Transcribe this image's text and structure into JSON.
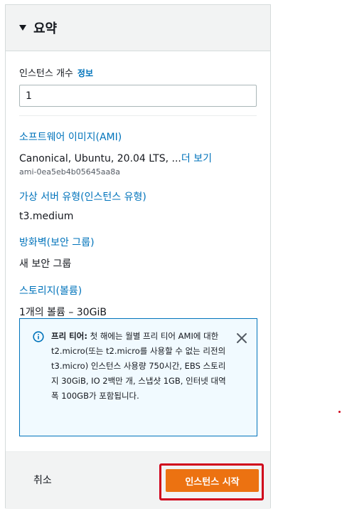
{
  "summary": {
    "title": "요약",
    "instance_count_label": "인스턴스 개수",
    "instance_count_info": "정보",
    "instance_count_value": "1",
    "ami_link": "소프트웨어 이미지(AMI)",
    "ami_value": "Canonical, Ubuntu, 20.04 LTS, ...",
    "ami_more_link": "더 보기",
    "ami_id": "ami-0ea5eb4b05645aa8a",
    "instance_type_link": "가상 서버 유형(인스턴스 유형)",
    "instance_type_value": "t3.medium",
    "firewall_link": "방화벽(보안 그룹)",
    "firewall_value": "새 보안 그룹",
    "storage_link": "스토리지(볼륨)",
    "storage_value": "1개의 볼륨 – 30GiB"
  },
  "free_tier_alert": {
    "title": "프리 티어:",
    "body": " 첫 해에는 월별 프리 티어 AMI에 대한 t2.micro(또는 t2.micro를 사용할 수 없는 리전의 t3.micro) 인스턴스 사용량 750시간, EBS 스토리지 30GiB, IO 2백만 개, 스냅샷 1GB, 인터넷 대역폭 100GB가 포함됩니다."
  },
  "footer": {
    "cancel_label": "취소",
    "launch_label": "인스턴스 시작"
  },
  "colors": {
    "link": "#0073bb",
    "primary_button": "#ec7211",
    "highlight_frame": "#d0021b"
  }
}
